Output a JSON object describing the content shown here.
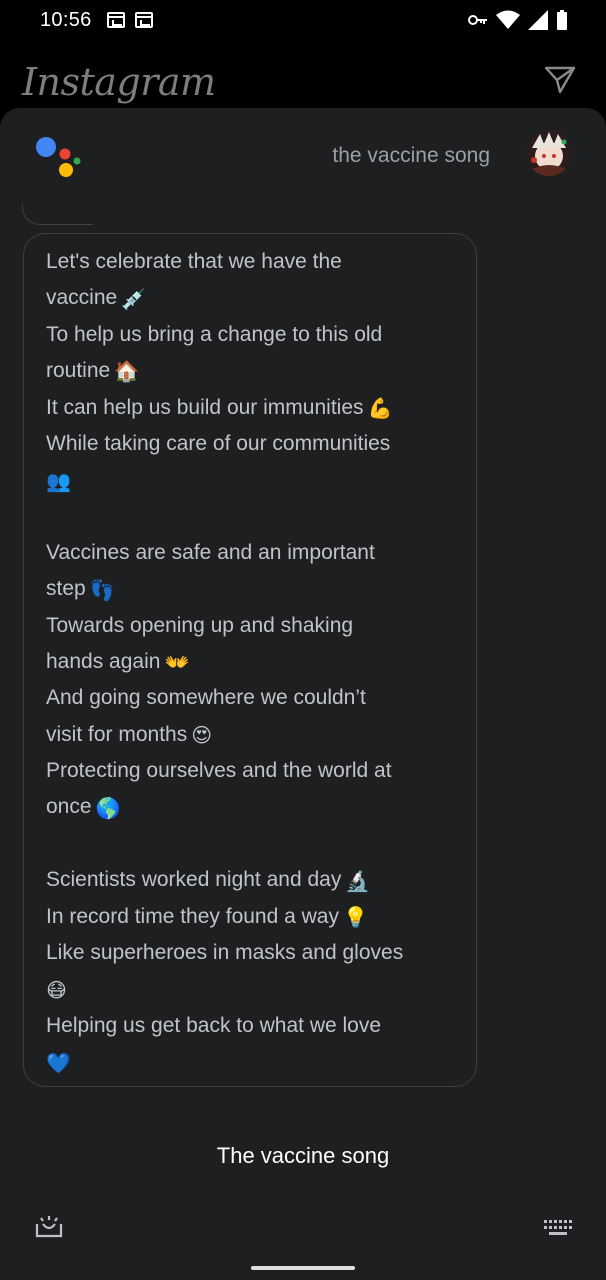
{
  "status_bar": {
    "time": "10:56",
    "icons": [
      "calendar-icon",
      "calendar-icon",
      "vpn-key-icon",
      "wifi-icon",
      "signal-icon",
      "battery-icon"
    ]
  },
  "background_app": {
    "logo_text": "Instagram",
    "send_icon": "direct-message-icon"
  },
  "assistant": {
    "query": "the vaccine song",
    "lyrics": [
      {
        "text": "Let's celebrate that we have the",
        "emoji": ""
      },
      {
        "text": "vaccine",
        "emoji": "💉"
      },
      {
        "text": "To help us bring a change to this old",
        "emoji": ""
      },
      {
        "text": "routine",
        "emoji": "🏠"
      },
      {
        "text": "It can help us build our immunities",
        "emoji": "💪"
      },
      {
        "text": "While taking care of our communities",
        "emoji": ""
      },
      {
        "text": "",
        "emoji": "👥"
      },
      {
        "text": "",
        "emoji": ""
      },
      {
        "text": "Vaccines are safe and an important",
        "emoji": ""
      },
      {
        "text": "step",
        "emoji": "👣"
      },
      {
        "text": "Towards opening up and shaking",
        "emoji": ""
      },
      {
        "text": "hands again",
        "emoji": "👐"
      },
      {
        "text": "And going somewhere we couldn’t",
        "emoji": ""
      },
      {
        "text": "visit for months",
        "emoji": "😍"
      },
      {
        "text": "Protecting ourselves and the world at",
        "emoji": ""
      },
      {
        "text": "once",
        "emoji": "🌎"
      },
      {
        "text": "",
        "emoji": ""
      },
      {
        "text": "Scientists worked night and day",
        "emoji": "🔬"
      },
      {
        "text": "In record time they found a way",
        "emoji": "💡"
      },
      {
        "text": "Like superheroes in masks and gloves",
        "emoji": ""
      },
      {
        "text": "",
        "emoji": "😷"
      },
      {
        "text": "Helping us get back to what we love",
        "emoji": ""
      },
      {
        "text": "",
        "emoji": "💙"
      }
    ],
    "response_title": "The vaccine song",
    "bottom_left_icon": "lens-icon",
    "bottom_right_icon": "keyboard-icon"
  },
  "colors": {
    "sheet_bg": "#1e1f21",
    "google_blue": "#4285f4",
    "google_red": "#ea4335",
    "google_yellow": "#fbbc05",
    "google_green": "#34a853"
  }
}
